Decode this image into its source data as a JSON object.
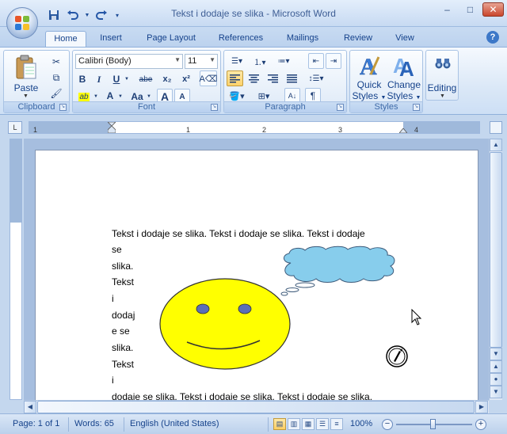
{
  "window": {
    "title": "Tekst i dodaje se slika - Microsoft Word",
    "minimize": "–",
    "maximize": "□",
    "close": "✕"
  },
  "qat": {
    "save_icon": "save-icon",
    "undo_icon": "undo-icon",
    "redo_icon": "redo-icon",
    "customize_icon": "customize-qat-icon"
  },
  "tabs": [
    {
      "label": "Home",
      "active": true
    },
    {
      "label": "Insert"
    },
    {
      "label": "Page Layout"
    },
    {
      "label": "References"
    },
    {
      "label": "Mailings"
    },
    {
      "label": "Review"
    },
    {
      "label": "View"
    }
  ],
  "ribbon": {
    "clipboard": {
      "label": "Clipboard",
      "paste": "Paste"
    },
    "font": {
      "label": "Font",
      "font_name": "Calibri (Body)",
      "font_size": "11",
      "bold": "B",
      "italic": "I",
      "underline": "U",
      "strike": "abe",
      "subscript": "x₂",
      "superscript": "x²",
      "change_case": "Aa",
      "grow": "A",
      "shrink": "A"
    },
    "paragraph": {
      "label": "Paragraph",
      "pilcrow": "¶"
    },
    "styles": {
      "label": "Styles",
      "quick_styles": "Quick\nStyles",
      "quick_line1": "Quick",
      "quick_line2": "Styles",
      "change_line1": "Change",
      "change_line2": "Styles"
    },
    "editing": {
      "label": "Editing"
    }
  },
  "ruler": {
    "corner": "L",
    "ticks": [
      "1",
      "1",
      "2",
      "3",
      "4"
    ]
  },
  "document": {
    "lines": [
      "Tekst i dodaje se slika. Tekst i dodaje se slika. Tekst i dodaje",
      "se",
      "slika.",
      "Tekst",
      "i",
      "dodaj",
      "e se",
      "slika.",
      "Tekst",
      "i",
      "dodaje se slika. Tekst i dodaje se slika. Tekst i dodaje se slika."
    ]
  },
  "status": {
    "page": "Page: 1 of 1",
    "words": "Words: 65",
    "language": "English (United States)",
    "zoom": "100%",
    "zoom_minus": "−",
    "zoom_plus": "+"
  },
  "colors": {
    "smiley_fill": "#ffff00",
    "smiley_eyes": "#5b6fb8",
    "cloud_fill": "#87cdec",
    "cloud_outline": "#3d5a7a"
  }
}
